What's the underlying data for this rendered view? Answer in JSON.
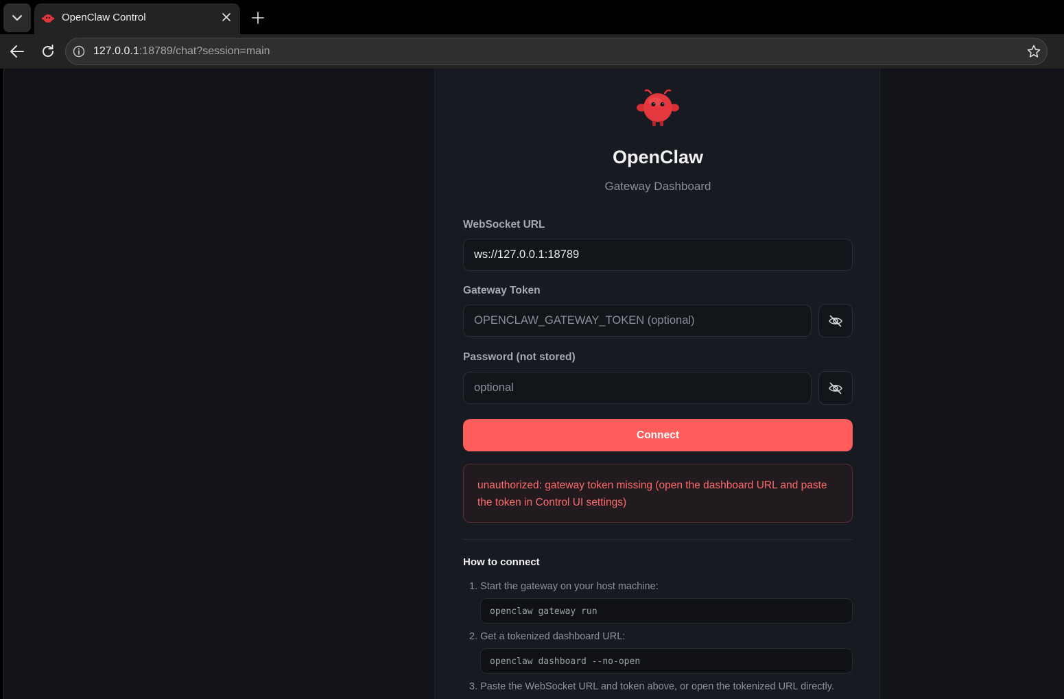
{
  "browser": {
    "tab_title": "OpenClaw Control",
    "url_host": "127.0.0.1",
    "url_rest": ":18789/chat?session=main"
  },
  "app": {
    "title": "OpenClaw",
    "subtitle": "Gateway Dashboard",
    "accent_color": "#ff5c5c"
  },
  "form": {
    "websocket_label": "WebSocket URL",
    "websocket_value": "ws://127.0.0.1:18789",
    "token_label": "Gateway Token",
    "token_placeholder": "OPENCLAW_GATEWAY_TOKEN (optional)",
    "password_label": "Password (not stored)",
    "password_placeholder": "optional",
    "connect_label": "Connect"
  },
  "error": {
    "message": "unauthorized: gateway token missing (open the dashboard URL and paste the token in Control UI settings)"
  },
  "howto": {
    "title": "How to connect",
    "steps": [
      {
        "text": "1. Start the gateway on your host machine:",
        "code": "openclaw gateway run"
      },
      {
        "text": "2. Get a tokenized dashboard URL:",
        "code": "openclaw dashboard --no-open"
      },
      {
        "text": "3. Paste the WebSocket URL and token above, or open the tokenized URL directly."
      }
    ]
  },
  "icons": {
    "tab_menu": "chevron-down-icon",
    "close": "close-icon",
    "new_tab": "plus-icon",
    "back": "arrow-left-icon",
    "reload": "reload-icon",
    "info": "info-icon",
    "star": "star-icon",
    "eye": "eye-off-icon"
  }
}
